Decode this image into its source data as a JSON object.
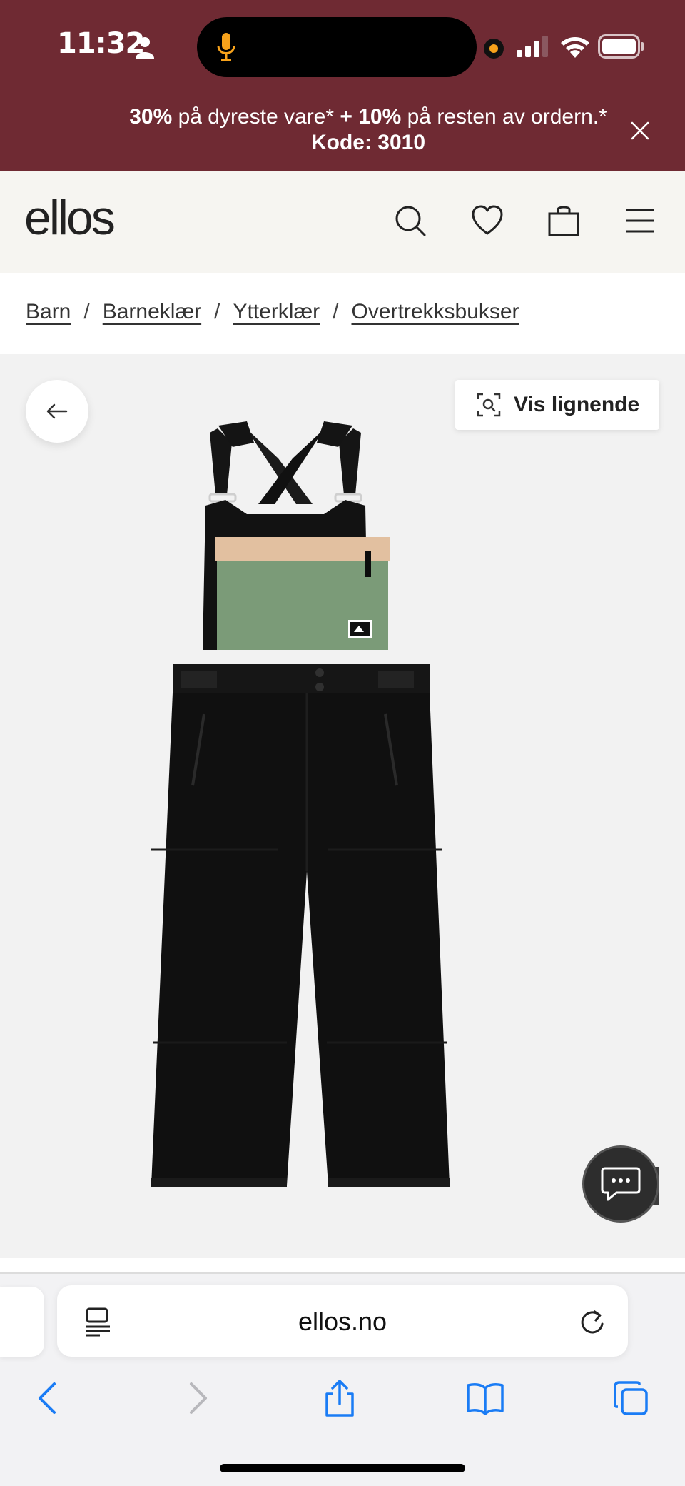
{
  "status_bar": {
    "time": "11:32",
    "icons": [
      "person-icon",
      "mic-icon",
      "signal-icon",
      "wifi-icon",
      "battery-icon"
    ]
  },
  "promo": {
    "pct1": "30%",
    "text1": " på dyreste vare* ",
    "pct2": "+ 10%",
    "text2": " på resten av ordern.*",
    "code": "Kode: 3010",
    "close_icon": "close-icon"
  },
  "header": {
    "logo": "ellos",
    "icons": [
      "search-icon",
      "heart-icon",
      "bag-icon",
      "menu-icon"
    ]
  },
  "breadcrumb": {
    "items": [
      "Barn",
      "Barneklær",
      "Ytterklær",
      "Overtrekksbukser"
    ],
    "separator": "/"
  },
  "product": {
    "similar_label": "Vis lignende",
    "image_alt": "Black bib snow pants with green and beige chest pocket"
  },
  "browser": {
    "url": "ellos.no"
  },
  "colors": {
    "maroon": "#6f2a33",
    "header_bg": "#f6f5f1",
    "product_bg": "#f2f2f2",
    "ios_blue": "#1a7cf5"
  }
}
